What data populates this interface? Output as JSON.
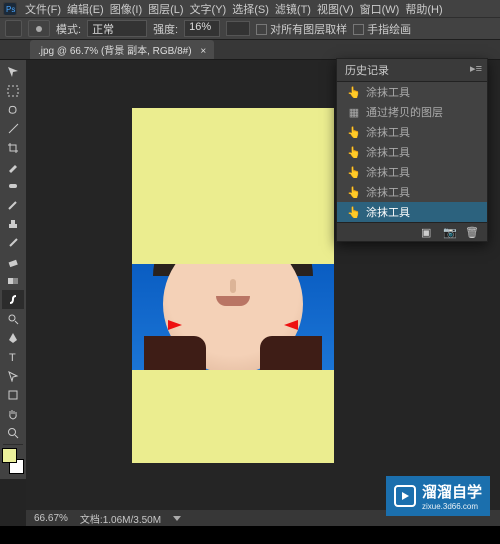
{
  "menu": {
    "items": [
      "文件(F)",
      "编辑(E)",
      "图像(I)",
      "图层(L)",
      "文字(Y)",
      "选择(S)",
      "滤镜(T)",
      "视图(V)",
      "窗口(W)",
      "帮助(H)"
    ]
  },
  "options": {
    "mode_label": "模式:",
    "mode_value": "正常",
    "strength_label": "强度:",
    "strength_value": "16%",
    "sample_all_label": "对所有图层取样",
    "finger_label": "手指绘画"
  },
  "tab": {
    "title": ".jpg @ 66.7% (背景 副本, RGB/8#)"
  },
  "history": {
    "title": "历史记录",
    "items": [
      {
        "label": "涂抹工具",
        "icon": "smudge"
      },
      {
        "label": "通过拷贝的图层",
        "icon": "layer"
      },
      {
        "label": "涂抹工具",
        "icon": "smudge"
      },
      {
        "label": "涂抹工具",
        "icon": "smudge"
      },
      {
        "label": "涂抹工具",
        "icon": "smudge"
      },
      {
        "label": "涂抹工具",
        "icon": "smudge"
      },
      {
        "label": "涂抹工具",
        "icon": "smudge",
        "selected": true
      }
    ]
  },
  "status": {
    "zoom": "66.67%",
    "doc": "文档:1.06M/3.50M"
  },
  "watermark": {
    "brand": "溜溜自学",
    "url": "zixue.3d66.com"
  },
  "colors": {
    "canvas_mask": "#ebed8f",
    "portrait_bg": "#1b75d6",
    "arrow": "#e11"
  }
}
